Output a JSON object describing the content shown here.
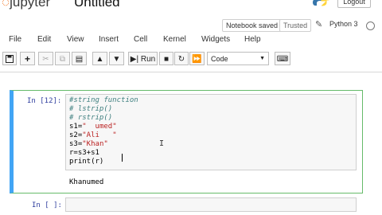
{
  "header": {
    "logo_text": "jupyter",
    "notebook_title": "Untitled",
    "save_status": "Notebook saved",
    "trusted_label": "Trusted",
    "kernel_name": "Python 3",
    "logout_label": "Logout"
  },
  "menu": {
    "items": [
      "File",
      "Edit",
      "View",
      "Insert",
      "Cell",
      "Kernel",
      "Widgets",
      "Help"
    ]
  },
  "toolbar": {
    "run_label": "Run",
    "cell_type": "Code"
  },
  "cells": [
    {
      "prompt": "In [12]:",
      "code_lines": [
        {
          "text": "#string function",
          "kind": "comment"
        },
        {
          "text": "# lstrip()",
          "kind": "comment"
        },
        {
          "text": "# rstrip()",
          "kind": "comment"
        },
        {
          "var": "s1=",
          "str": "\"  umed\""
        },
        {
          "var": "s2=",
          "str": "\"Ali   \""
        },
        {
          "var": "s3=",
          "str": "\"Khan\""
        },
        {
          "text": "r=s3+s1",
          "kind": "plain"
        },
        {
          "text": "print(r)",
          "kind": "plain"
        }
      ],
      "output": "Khanumed"
    },
    {
      "prompt": "In [ ]:"
    }
  ],
  "colors": {
    "selected_cell_border": "#66bb6a",
    "cell_left_bar": "#42a5f5",
    "prompt_color": "#303f9f",
    "comment_color": "#408080",
    "string_color": "#ba2121"
  }
}
